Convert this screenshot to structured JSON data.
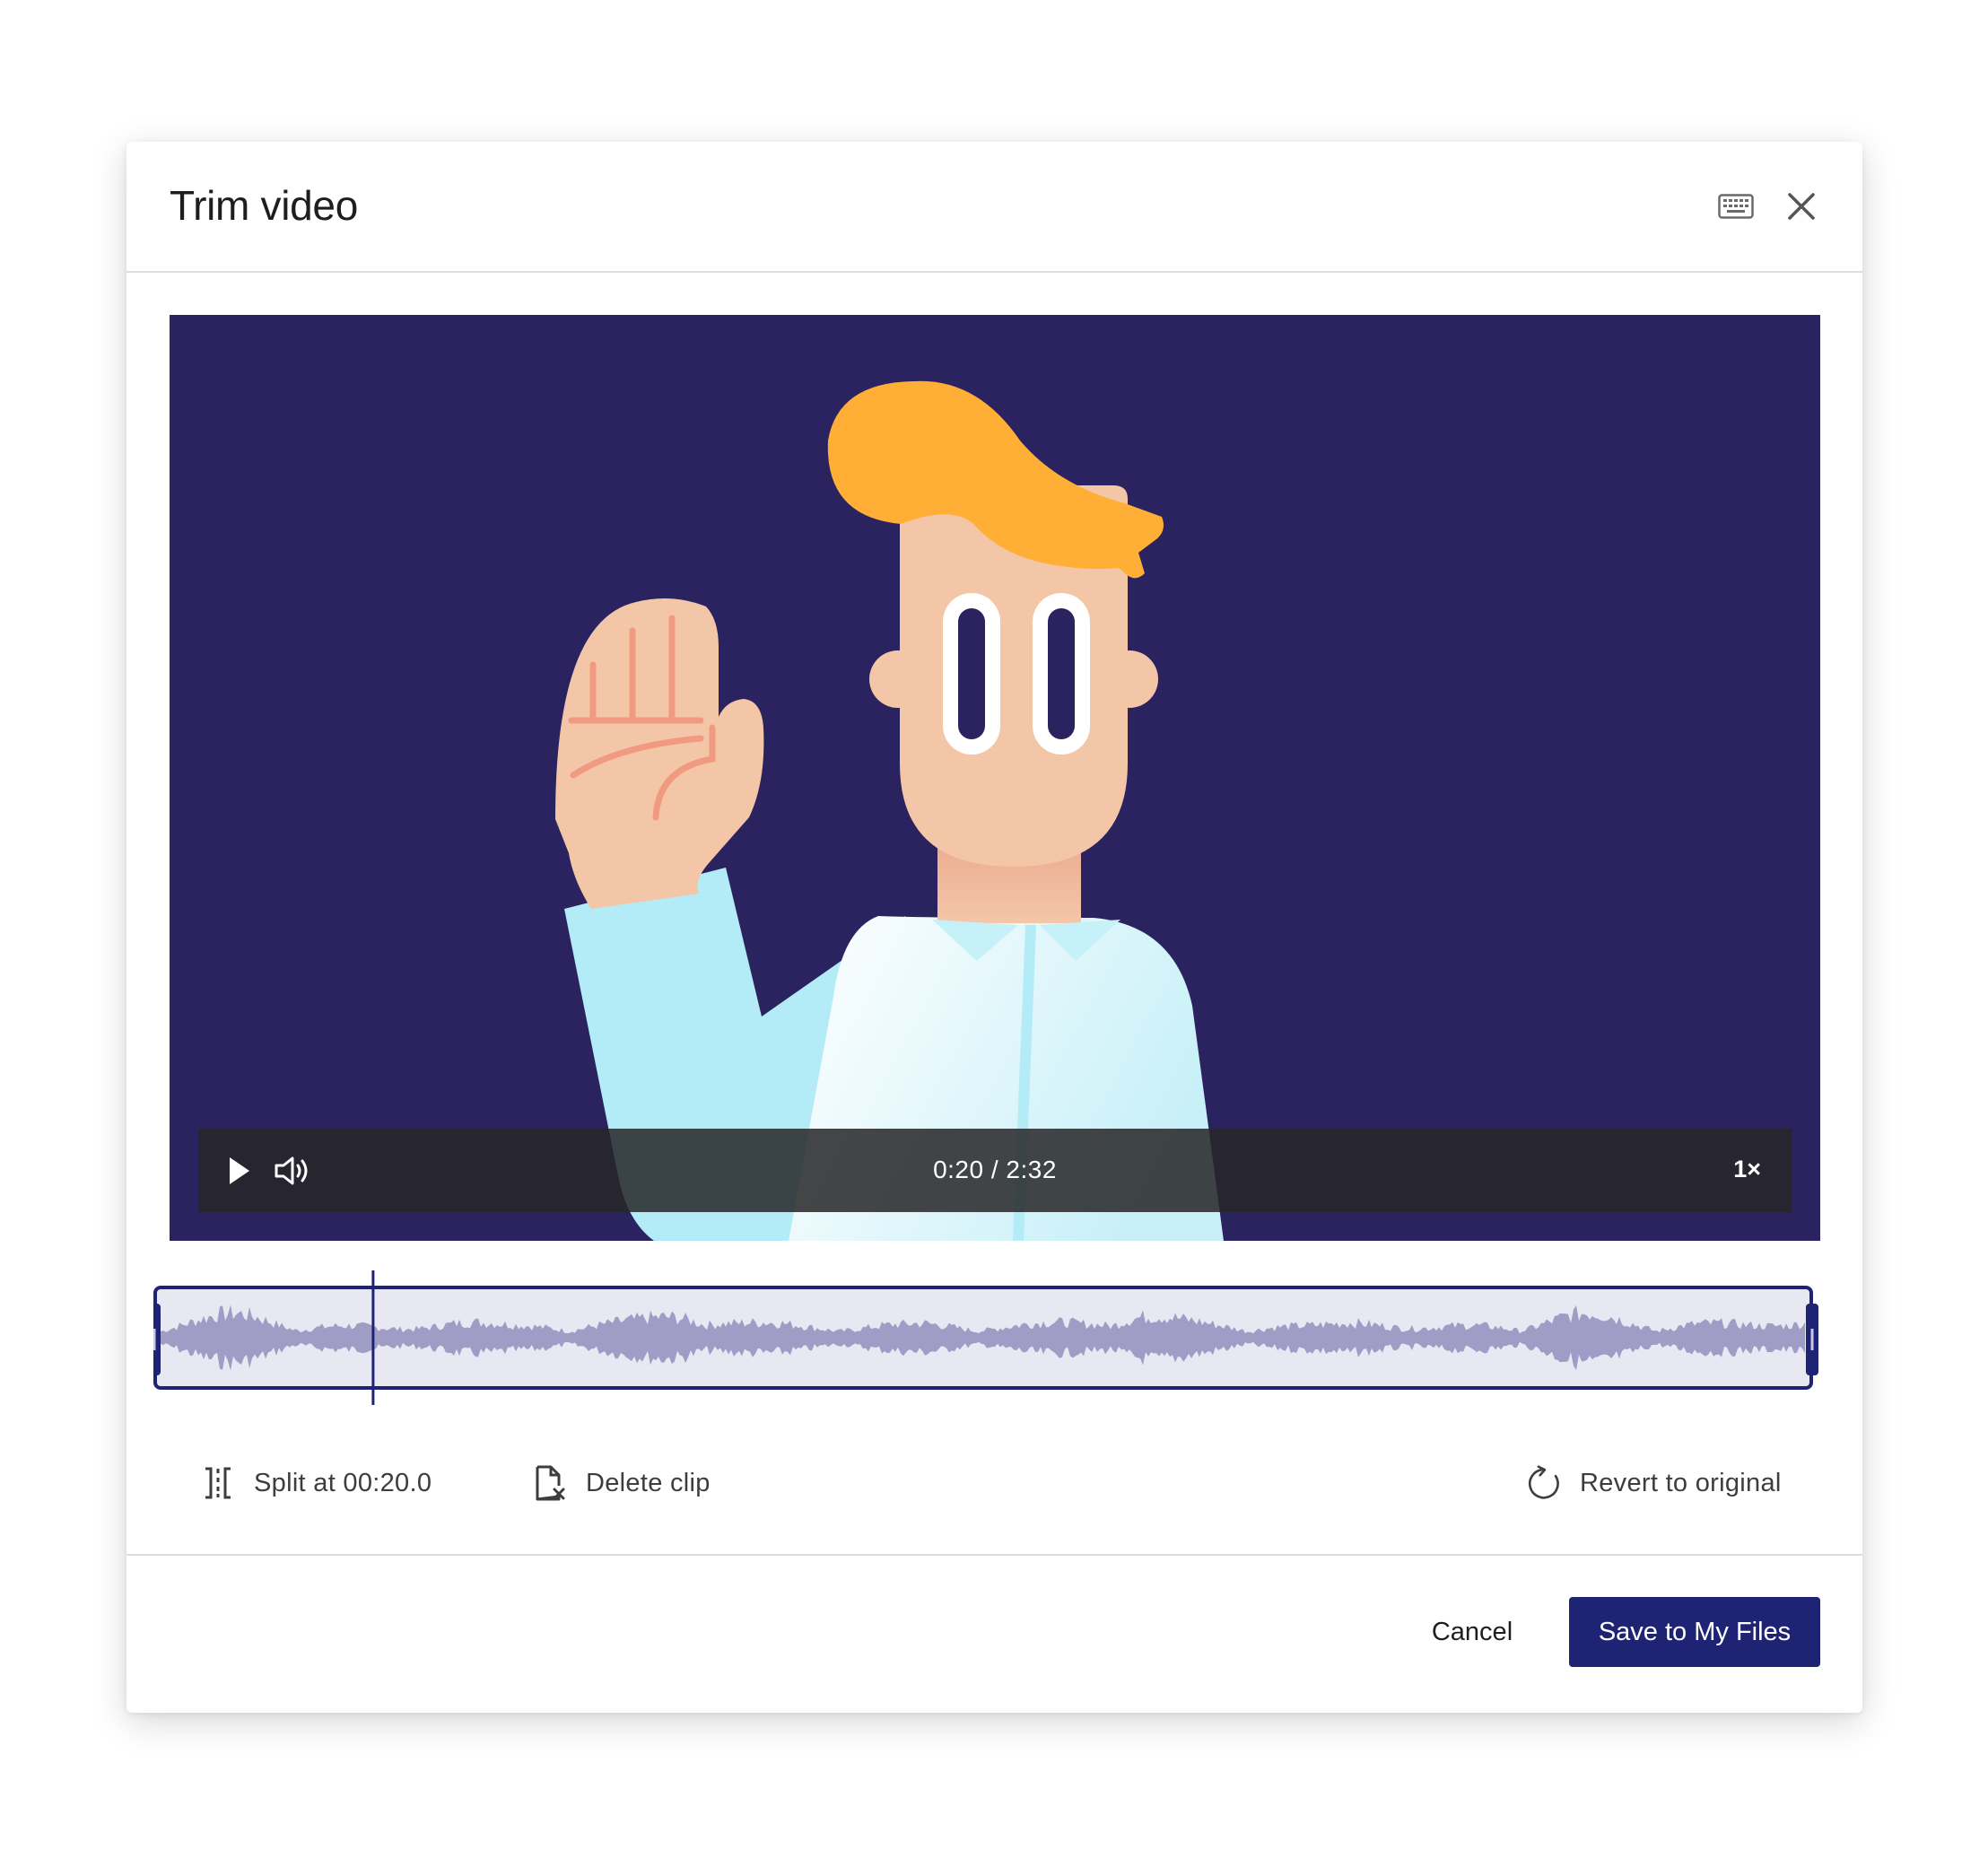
{
  "dialog": {
    "title": "Trim video",
    "keyboard_icon": "keyboard-icon",
    "close_icon": "close-icon"
  },
  "player": {
    "time_display": "0:20 / 2:32",
    "speed": "1×",
    "play_icon": "play-icon",
    "volume_icon": "volume-icon",
    "playhead_seconds": 20,
    "duration_seconds": 152
  },
  "tools": {
    "split_label": "Split at 00:20.0",
    "delete_label": "Delete clip",
    "revert_label": "Revert to original"
  },
  "footer": {
    "cancel_label": "Cancel",
    "save_label": "Save to My Files"
  },
  "colors": {
    "accent": "#1f2374",
    "video_bg": "#2b2260",
    "waveform": "#9f9dc6",
    "waveform_bg": "#e8e8f3"
  }
}
